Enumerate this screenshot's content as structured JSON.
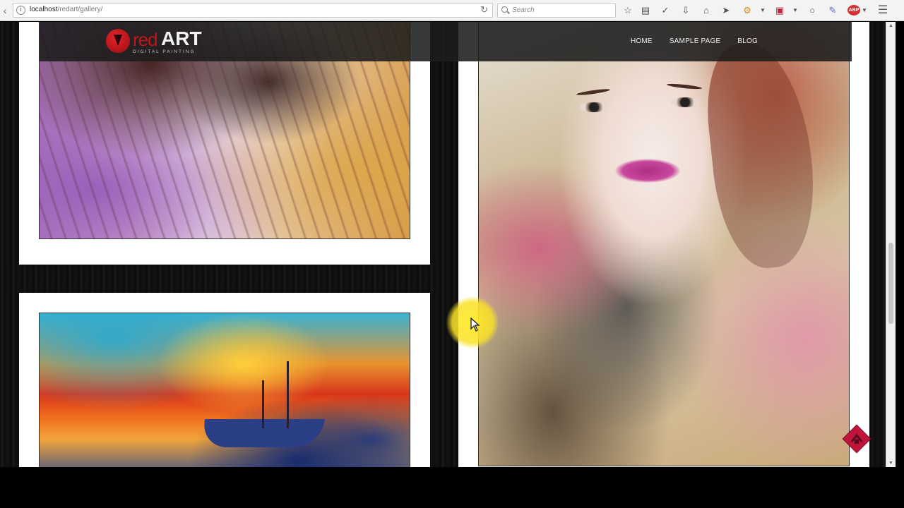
{
  "browser": {
    "url_host": "localhost",
    "url_path": "/redart/gallery/",
    "search_placeholder": "Search",
    "toolbar_icons": [
      "bookmark-star-icon",
      "reading-list-icon",
      "pocket-icon",
      "download-icon",
      "home-icon",
      "send-icon",
      "extension-icon",
      "screenshot-icon",
      "chat-icon",
      "pen-icon",
      "adblock-icon",
      "menu-icon"
    ],
    "adblock_badge": "ABP"
  },
  "site": {
    "logo": {
      "red": "red",
      "art": "ART",
      "tagline": "DIGITAL PAINTING"
    },
    "nav": [
      {
        "label": "HOME"
      },
      {
        "label": "SAMPLE PAGE"
      },
      {
        "label": "BLOG"
      }
    ],
    "accent_color": "#c2151b"
  },
  "gallery": [
    {
      "id": "painting-1",
      "subject": "abstract-horse-mane"
    },
    {
      "id": "painting-2",
      "subject": "sunset-sailboat"
    },
    {
      "id": "painting-3",
      "subject": "woman-portrait"
    }
  ]
}
